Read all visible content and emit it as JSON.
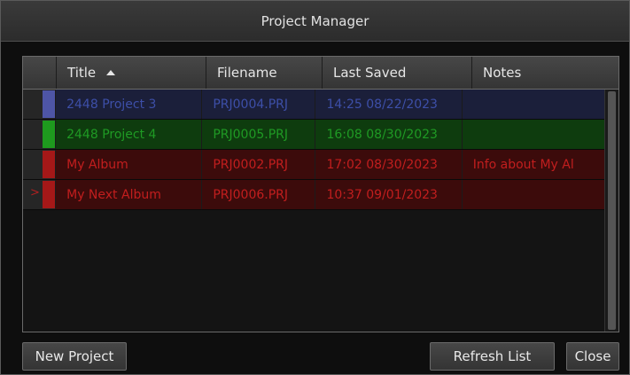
{
  "window": {
    "title": "Project Manager"
  },
  "table": {
    "columns": [
      {
        "label": "",
        "sortable": false
      },
      {
        "label": "Title",
        "sorted": "ascending"
      },
      {
        "label": "Filename"
      },
      {
        "label": "Last Saved"
      },
      {
        "label": "Notes"
      }
    ],
    "rows": [
      {
        "selected_marker": "",
        "title": "2448 Project 3",
        "filename": "PRJ0004.PRJ",
        "last_saved": "14:25 08/22/2023",
        "notes": "",
        "row_color": "#1b1f3a",
        "swatch_color": "#4e55a6",
        "text_color": "#3d4fa8"
      },
      {
        "selected_marker": "",
        "title": "2448 Project 4",
        "filename": "PRJ0005.PRJ",
        "last_saved": "16:08 08/30/2023",
        "notes": "",
        "row_color": "#0e3c0e",
        "swatch_color": "#1e9a1e",
        "text_color": "#1f9a24"
      },
      {
        "selected_marker": "",
        "title": "My Album",
        "filename": "PRJ0002.PRJ",
        "last_saved": "17:02 08/30/2023",
        "notes": "Info about My Al",
        "row_color": "#3c0b0b",
        "swatch_color": "#a51818",
        "text_color": "#c21e1e"
      },
      {
        "selected_marker": ">",
        "title": "My Next Album",
        "filename": "PRJ0006.PRJ",
        "last_saved": "10:37 09/01/2023",
        "notes": "",
        "row_color": "#3c0b0b",
        "swatch_color": "#a51818",
        "text_color": "#c21e1e"
      }
    ]
  },
  "buttons": {
    "new_project": "New Project",
    "refresh_list": "Refresh List",
    "close": "Close"
  }
}
